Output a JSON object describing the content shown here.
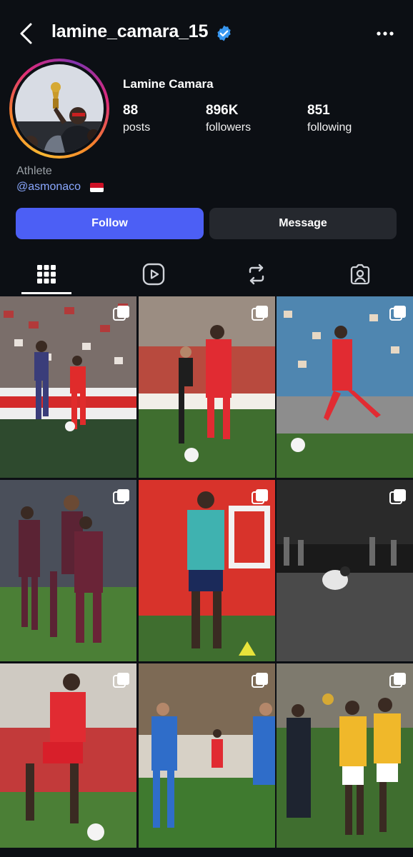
{
  "header": {
    "username": "lamine_camara_15"
  },
  "profile": {
    "display_name": "Lamine Camara",
    "stats": [
      {
        "value": "88",
        "label": "posts"
      },
      {
        "value": "896K",
        "label": "followers"
      },
      {
        "value": "851",
        "label": "following"
      }
    ],
    "category": "Athlete",
    "link": "@asmonaco"
  },
  "actions": {
    "follow_label": "Follow",
    "message_label": "Message"
  },
  "tabs": [
    {
      "icon": "grid-icon",
      "active": true
    },
    {
      "icon": "reels-icon",
      "active": false
    },
    {
      "icon": "reposts-icon",
      "active": false
    },
    {
      "icon": "tagged-icon",
      "active": false
    }
  ],
  "posts": [
    {
      "kind": "carousel"
    },
    {
      "kind": "carousel"
    },
    {
      "kind": "carousel"
    },
    {
      "kind": "carousel"
    },
    {
      "kind": "carousel"
    },
    {
      "kind": "carousel"
    },
    {
      "kind": "carousel"
    },
    {
      "kind": "carousel"
    },
    {
      "kind": "carousel"
    }
  ],
  "colors": {
    "background": "#0c0f14",
    "follow_button": "#4c5ff5",
    "message_button": "#25282e",
    "verified": "#3897f0",
    "link": "#8aa8ff"
  }
}
